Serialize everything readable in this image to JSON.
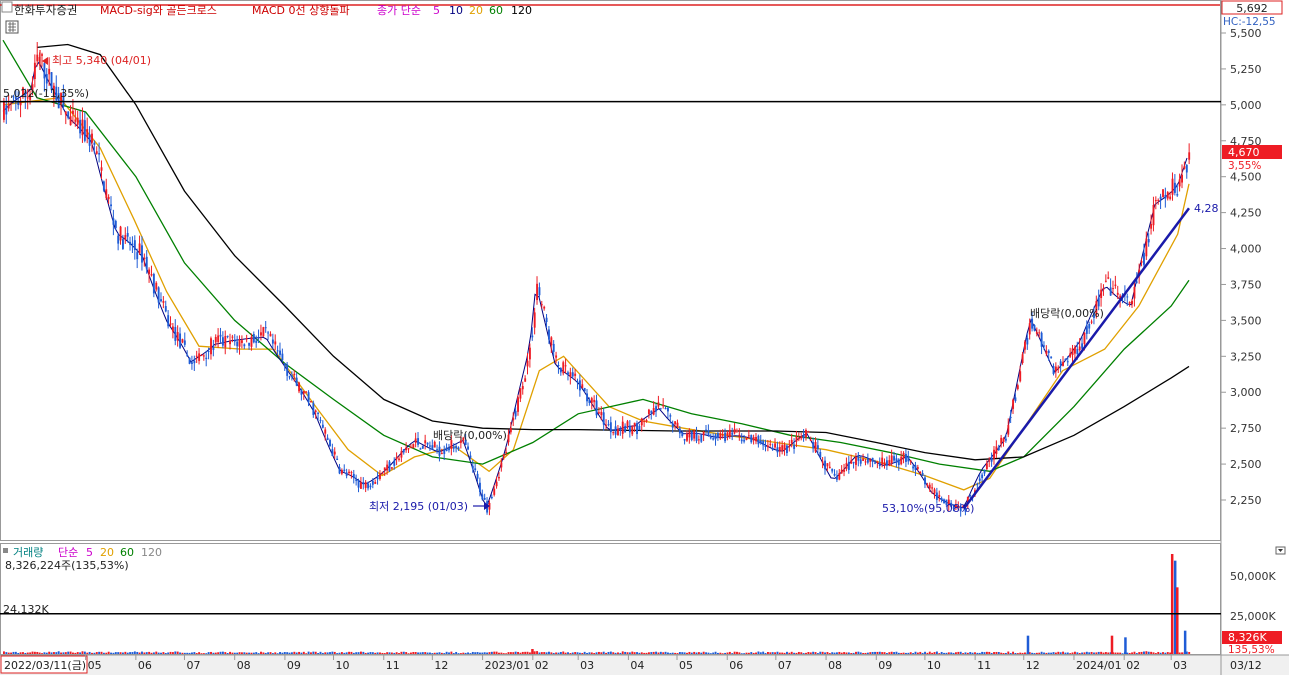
{
  "legend_top": {
    "stock_name": "한화투자증권",
    "items": [
      {
        "label": "MACD-sig와 골든크로스",
        "color": "#cc0000"
      },
      {
        "label": "MACD 0선 상향돌파",
        "color": "#cc0000"
      },
      {
        "label": "종가 단순",
        "color": "#cc00cc"
      }
    ],
    "ma_periods": [
      {
        "label": "5",
        "color": "#cc00cc"
      },
      {
        "label": "10",
        "color": "#000080"
      },
      {
        "label": "20",
        "color": "#e0a000"
      },
      {
        "label": "60",
        "color": "#008000"
      },
      {
        "label": "120",
        "color": "#000000"
      }
    ]
  },
  "legend_volume": {
    "title": "거래량",
    "mode": "단순",
    "ma_periods": [
      {
        "label": "5",
        "color": "#cc00cc"
      },
      {
        "label": "20",
        "color": "#e0a000"
      },
      {
        "label": "60",
        "color": "#008000"
      },
      {
        "label": "120",
        "color": "#888888"
      }
    ],
    "current_text": "8,326,224주(135,53%)"
  },
  "annotations": {
    "high": "최고 5,340 (04/01)",
    "low": "최저 2,195 (01/03)",
    "level_left": "5,022(-11,35%)",
    "ex_div_1": "배당락(0,00%)",
    "ex_div_2": "배당락(0,00%)",
    "low_ratio": "53,10%(95,08%)",
    "trendline_end": "4,28",
    "volume_level": "24,132K"
  },
  "price_axis": {
    "top_box": "5,692",
    "hc": "HC:-12,55",
    "current_price": "4,670",
    "current_change": "3,55%",
    "ticks": [
      "5,500",
      "5,250",
      "5,000",
      "4,750",
      "4,500",
      "4,250",
      "4,000",
      "3,750",
      "3,500",
      "3,250",
      "3,000",
      "2,750",
      "2,500",
      "2,250"
    ]
  },
  "volume_axis": {
    "ticks": [
      "50,000K",
      "25,000K"
    ],
    "current_volume": "8,326K",
    "current_pct": "135,53%"
  },
  "x_axis": {
    "first_date": "2022/03/11(금)",
    "labels": [
      "05",
      "06",
      "07",
      "08",
      "09",
      "10",
      "11",
      "12",
      "2023/01",
      "02",
      "03",
      "04",
      "05",
      "06",
      "07",
      "08",
      "09",
      "10",
      "11",
      "12",
      "2024/01",
      "02",
      "03"
    ],
    "right_label": "03/12"
  },
  "colors": {
    "up": "#ee1c24",
    "down": "#1f5cd6",
    "trendline": "#1a1aaa",
    "frame_red": "#dd2222"
  },
  "chart_data": {
    "type": "candlestick",
    "ylim": [
      2100,
      5700
    ],
    "volume_ylim_k": [
      0,
      66000
    ],
    "horizontal_levels": [
      5022
    ],
    "volume_horizontal_level_k": 24132,
    "price_path": [
      [
        "2022/03/11",
        4950
      ],
      [
        "2022/03/28",
        5100
      ],
      [
        "2022/04/01",
        5340
      ],
      [
        "2022/04/20",
        4900
      ],
      [
        "2022/05/05",
        4750
      ],
      [
        "2022/05/20",
        4100
      ],
      [
        "2022/06/05",
        3950
      ],
      [
        "2022/06/20",
        3500
      ],
      [
        "2022/07/05",
        3200
      ],
      [
        "2022/07/20",
        3350
      ],
      [
        "2022/08/05",
        3350
      ],
      [
        "2022/08/20",
        3400
      ],
      [
        "2022/09/05",
        3100
      ],
      [
        "2022/09/20",
        2850
      ],
      [
        "2022/10/05",
        2450
      ],
      [
        "2022/10/20",
        2350
      ],
      [
        "2022/11/05",
        2500
      ],
      [
        "2022/11/20",
        2650
      ],
      [
        "2022/12/05",
        2600
      ],
      [
        "2022/12/20",
        2650
      ],
      [
        "2023/01/03",
        2195
      ],
      [
        "2023/01/15",
        2600
      ],
      [
        "2023/01/30",
        3300
      ],
      [
        "2023/02/03",
        3750
      ],
      [
        "2023/02/15",
        3200
      ],
      [
        "2023/03/01",
        3050
      ],
      [
        "2023/03/20",
        2750
      ],
      [
        "2023/04/05",
        2750
      ],
      [
        "2023/04/20",
        2900
      ],
      [
        "2023/05/05",
        2700
      ],
      [
        "2023/05/20",
        2700
      ],
      [
        "2023/06/05",
        2700
      ],
      [
        "2023/06/20",
        2650
      ],
      [
        "2023/07/05",
        2600
      ],
      [
        "2023/07/20",
        2700
      ],
      [
        "2023/08/05",
        2400
      ],
      [
        "2023/08/20",
        2550
      ],
      [
        "2023/09/05",
        2500
      ],
      [
        "2023/09/20",
        2550
      ],
      [
        "2023/10/05",
        2300
      ],
      [
        "2023/10/25",
        2190
      ],
      [
        "2023/11/05",
        2450
      ],
      [
        "2023/11/20",
        2700
      ],
      [
        "2023/12/05",
        3500
      ],
      [
        "2023/12/20",
        3150
      ],
      [
        "2024/01/05",
        3350
      ],
      [
        "2024/01/20",
        3750
      ],
      [
        "2024/02/05",
        3600
      ],
      [
        "2024/02/20",
        4300
      ],
      [
        "2024/03/05",
        4450
      ],
      [
        "2024/03/12",
        4670
      ]
    ],
    "moving_averages": [
      {
        "name": "20",
        "color": "#e0a000",
        "points": [
          [
            "2022/03/11",
            5000
          ],
          [
            "2022/04/15",
            5050
          ],
          [
            "2022/05/10",
            4700
          ],
          [
            "2022/05/31",
            4200
          ],
          [
            "2022/06/20",
            3700
          ],
          [
            "2022/07/10",
            3320
          ],
          [
            "2022/08/05",
            3300
          ],
          [
            "2022/08/25",
            3300
          ],
          [
            "2022/09/20",
            2900
          ],
          [
            "2022/10/10",
            2600
          ],
          [
            "2022/10/31",
            2420
          ],
          [
            "2022/11/20",
            2550
          ],
          [
            "2022/12/15",
            2620
          ],
          [
            "2023/01/05",
            2450
          ],
          [
            "2023/01/20",
            2600
          ],
          [
            "2023/02/05",
            3150
          ],
          [
            "2023/02/20",
            3250
          ],
          [
            "2023/03/20",
            2900
          ],
          [
            "2023/04/10",
            2800
          ],
          [
            "2023/05/05",
            2750
          ],
          [
            "2023/06/01",
            2700
          ],
          [
            "2023/07/01",
            2650
          ],
          [
            "2023/08/01",
            2600
          ],
          [
            "2023/09/01",
            2520
          ],
          [
            "2023/10/01",
            2420
          ],
          [
            "2023/10/25",
            2320
          ],
          [
            "2023/11/10",
            2400
          ],
          [
            "2023/12/01",
            2750
          ],
          [
            "2023/12/25",
            3150
          ],
          [
            "2024/01/20",
            3300
          ],
          [
            "2024/02/10",
            3600
          ],
          [
            "2024/03/05",
            4100
          ],
          [
            "2024/03/12",
            4450
          ]
        ]
      },
      {
        "name": "60",
        "color": "#008000",
        "points": [
          [
            "2022/03/11",
            5450
          ],
          [
            "2022/04/01",
            5050
          ],
          [
            "2022/05/01",
            4950
          ],
          [
            "2022/06/01",
            4500
          ],
          [
            "2022/07/01",
            3900
          ],
          [
            "2022/08/01",
            3500
          ],
          [
            "2022/09/01",
            3200
          ],
          [
            "2022/10/01",
            2950
          ],
          [
            "2022/11/01",
            2700
          ],
          [
            "2022/12/01",
            2550
          ],
          [
            "2023/01/01",
            2500
          ],
          [
            "2023/02/01",
            2650
          ],
          [
            "2023/03/01",
            2850
          ],
          [
            "2023/04/10",
            2950
          ],
          [
            "2023/05/10",
            2850
          ],
          [
            "2023/06/10",
            2780
          ],
          [
            "2023/07/10",
            2700
          ],
          [
            "2023/08/10",
            2650
          ],
          [
            "2023/09/10",
            2580
          ],
          [
            "2023/10/10",
            2500
          ],
          [
            "2023/11/10",
            2450
          ],
          [
            "2023/12/01",
            2550
          ],
          [
            "2024/01/01",
            2900
          ],
          [
            "2024/02/01",
            3300
          ],
          [
            "2024/03/01",
            3600
          ],
          [
            "2024/03/12",
            3780
          ]
        ]
      },
      {
        "name": "120",
        "color": "#000000",
        "points": [
          [
            "2022/04/01",
            5400
          ],
          [
            "2022/04/20",
            5420
          ],
          [
            "2022/05/10",
            5350
          ],
          [
            "2022/06/01",
            5000
          ],
          [
            "2022/07/01",
            4400
          ],
          [
            "2022/08/01",
            3950
          ],
          [
            "2022/09/01",
            3600
          ],
          [
            "2022/10/01",
            3250
          ],
          [
            "2022/11/01",
            2950
          ],
          [
            "2022/12/01",
            2800
          ],
          [
            "2023/01/01",
            2750
          ],
          [
            "2023/02/01",
            2740
          ],
          [
            "2023/03/01",
            2740
          ],
          [
            "2023/05/01",
            2730
          ],
          [
            "2023/07/01",
            2730
          ],
          [
            "2023/08/01",
            2720
          ],
          [
            "2023/09/01",
            2650
          ],
          [
            "2023/10/01",
            2580
          ],
          [
            "2023/11/01",
            2530
          ],
          [
            "2023/12/01",
            2550
          ],
          [
            "2024/01/01",
            2700
          ],
          [
            "2024/02/01",
            2900
          ],
          [
            "2024/03/01",
            3100
          ],
          [
            "2024/03/12",
            3180
          ]
        ]
      }
    ],
    "trendline": [
      [
        "2023/10/25",
        2190
      ],
      [
        "2024/03/12",
        4280
      ]
    ],
    "volume_spikes_k": [
      [
        "2023/01/31",
        3000
      ],
      [
        "2023/12/01",
        11000
      ],
      [
        "2024/01/20",
        11000
      ],
      [
        "2024/02/01",
        10000
      ],
      [
        "2024/02/28",
        60000
      ],
      [
        "2024/02/28",
        56000
      ],
      [
        "2024/03/04",
        40000
      ],
      [
        "2024/03/07",
        14000
      ]
    ]
  }
}
